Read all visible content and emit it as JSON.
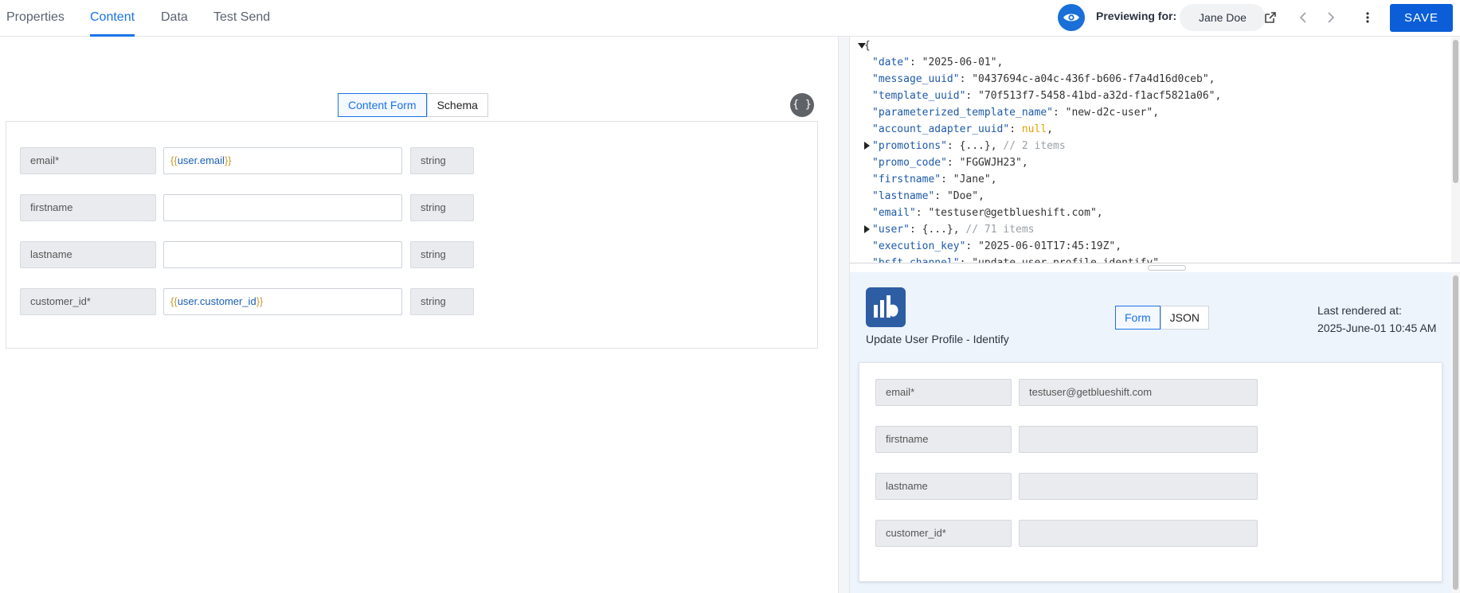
{
  "tabs": [
    {
      "label": "Properties"
    },
    {
      "label": "Content"
    },
    {
      "label": "Data"
    },
    {
      "label": "Test Send"
    }
  ],
  "header": {
    "previewing_label": "Previewing for:",
    "preview_user": "Jane Doe",
    "save_label": "SAVE"
  },
  "content_tabs": {
    "form": "Content Form",
    "schema": "Schema"
  },
  "json_toggle": "{ }",
  "fields": [
    {
      "label": "email*",
      "value_open": "{{",
      "value": "user.email",
      "value_close": "}}",
      "type": "string"
    },
    {
      "label": "firstname",
      "value_open": "",
      "value": "",
      "value_close": "",
      "type": "string"
    },
    {
      "label": "lastname",
      "value_open": "",
      "value": "",
      "value_close": "",
      "type": "string"
    },
    {
      "label": "customer_id*",
      "value_open": "{{",
      "value": "user.customer_id",
      "value_close": "}}",
      "type": "string"
    }
  ],
  "json_lines": [
    {
      "open": "{"
    },
    {
      "key": "\"date\"",
      "val": "\"2025-06-01\"",
      "tail": ","
    },
    {
      "key": "\"message_uuid\"",
      "val": "\"0437694c-a04c-436f-b606-f7a4d16d0ceb\"",
      "tail": ","
    },
    {
      "key": "\"template_uuid\"",
      "val": "\"70f513f7-5458-41bd-a32d-f1acf5821a06\"",
      "tail": ","
    },
    {
      "key": "\"parameterized_template_name\"",
      "val": "\"new-d2c-user\"",
      "tail": ","
    },
    {
      "key": "\"account_adapter_uuid\"",
      "null": "null",
      "tail": ","
    },
    {
      "key": "\"promotions\"",
      "val": "{...}",
      "tail": ",",
      "comment": "// 2 items",
      "collapsed": true
    },
    {
      "key": "\"promo_code\"",
      "val": "\"FGGWJH23\"",
      "tail": ","
    },
    {
      "key": "\"firstname\"",
      "val": "\"Jane\"",
      "tail": ","
    },
    {
      "key": "\"lastname\"",
      "val": "\"Doe\"",
      "tail": ","
    },
    {
      "key": "\"email\"",
      "val": "\"testuser@getblueshift.com\"",
      "tail": ","
    },
    {
      "key": "\"user\"",
      "val": "{...}",
      "tail": ",",
      "comment": "// 71 items",
      "collapsed": true
    },
    {
      "key": "\"execution_key\"",
      "val": "\"2025-06-01T17:45:19Z\"",
      "tail": ","
    },
    {
      "key": "\"bsft_channel\"",
      "val": "\"update_user_profile_identify\"",
      "tail": ","
    }
  ],
  "preview": {
    "title": "Update User Profile - Identify",
    "tabs": {
      "form": "Form",
      "json": "JSON"
    },
    "last_rendered_label": "Last rendered at:",
    "last_rendered_value": "2025-June-01 10:45 AM",
    "fields": [
      {
        "label": "email*",
        "value": "testuser@getblueshift.com"
      },
      {
        "label": "firstname",
        "value": ""
      },
      {
        "label": "lastname",
        "value": ""
      },
      {
        "label": "customer_id*",
        "value": ""
      }
    ]
  },
  "colors": {
    "accent": "#1a73e8",
    "save": "#0b5ed7",
    "logo": "#2d5ea3"
  },
  "icons": [
    "eye-icon",
    "external-link-icon",
    "chevron-left-icon",
    "chevron-right-icon",
    "kebab-menu-icon",
    "braces-icon",
    "brand-logo-icon",
    "expand-triangle-icon"
  ]
}
